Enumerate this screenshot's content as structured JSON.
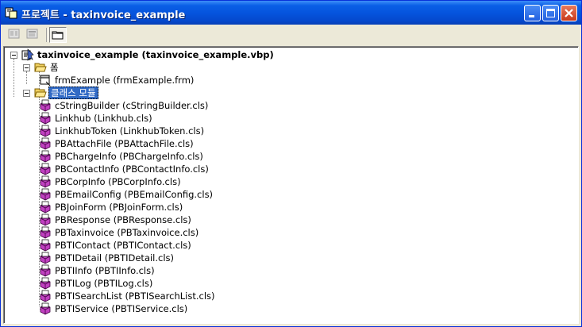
{
  "window": {
    "title": "프로젝트 - taxinvoice_example"
  },
  "toolbar": {
    "buttons": [
      "view-code-icon",
      "view-object-icon",
      "toggle-folders-icon"
    ]
  },
  "tree": {
    "project": {
      "label": "taxinvoice_example (taxinvoice_example.vbp)",
      "icon": "vb-project-icon"
    },
    "forms_folder": {
      "label": "폼",
      "icon": "folder-open-icon"
    },
    "forms": [
      {
        "label": "frmExample (frmExample.frm)",
        "icon": "form-icon"
      }
    ],
    "classes_folder": {
      "label": "클래스 모듈",
      "icon": "folder-open-icon",
      "selected": true
    },
    "classes": [
      {
        "label": "cStringBuilder (cStringBuilder.cls)"
      },
      {
        "label": "Linkhub (Linkhub.cls)"
      },
      {
        "label": "LinkhubToken (LinkhubToken.cls)"
      },
      {
        "label": "PBAttachFile (PBAttachFile.cls)"
      },
      {
        "label": "PBChargeInfo (PBChargeInfo.cls)"
      },
      {
        "label": "PBContactInfo (PBContactInfo.cls)"
      },
      {
        "label": "PBCorpInfo (PBCorpInfo.cls)"
      },
      {
        "label": "PBEmailConfig (PBEmailConfig.cls)"
      },
      {
        "label": "PBJoinForm (PBJoinForm.cls)"
      },
      {
        "label": "PBResponse (PBResponse.cls)"
      },
      {
        "label": "PBTaxinvoice (PBTaxinvoice.cls)"
      },
      {
        "label": "PBTIContact (PBTIContact.cls)"
      },
      {
        "label": "PBTIDetail (PBTIDetail.cls)"
      },
      {
        "label": "PBTIInfo (PBTIInfo.cls)"
      },
      {
        "label": "PBTILog (PBTILog.cls)"
      },
      {
        "label": "PBTISearchList (PBTISearchList.cls)"
      },
      {
        "label": "PBTIService (PBTIService.cls)"
      }
    ]
  },
  "colors": {
    "titlebar": "#0553dc",
    "selection": "#316ac5"
  }
}
